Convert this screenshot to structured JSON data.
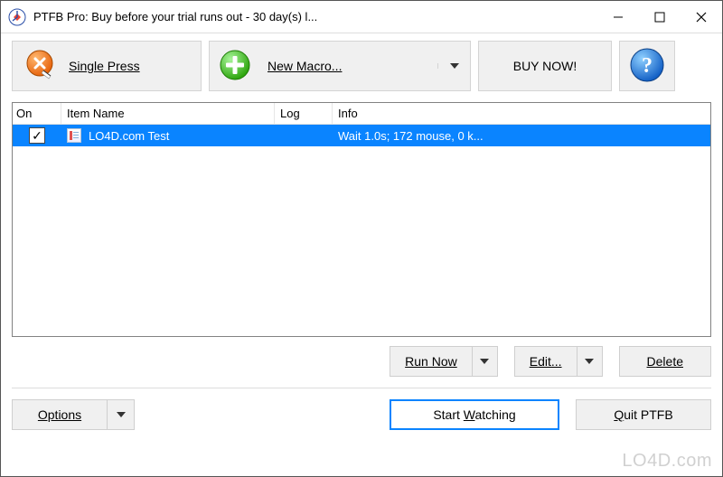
{
  "window": {
    "title": "PTFB Pro: Buy before your trial runs out - 30 day(s) l..."
  },
  "toolbar": {
    "single_press_label": "Single Press",
    "new_macro_label": "New Macro...",
    "buy_now_label": "BUY NOW!"
  },
  "list": {
    "columns": {
      "on": "On",
      "item_name": "Item Name",
      "log": "Log",
      "info": "Info"
    },
    "rows": [
      {
        "checked": true,
        "name": "LO4D.com Test",
        "log": "",
        "info": "Wait 1.0s; 172 mouse, 0 k..."
      }
    ]
  },
  "row_buttons": {
    "run_now": "Run Now",
    "edit": "Edit...",
    "delete": "Delete"
  },
  "bottom": {
    "options": "Options",
    "start_watching": "Start Watching",
    "quit": "Quit PTFB"
  },
  "watermark": "LO4D.com"
}
